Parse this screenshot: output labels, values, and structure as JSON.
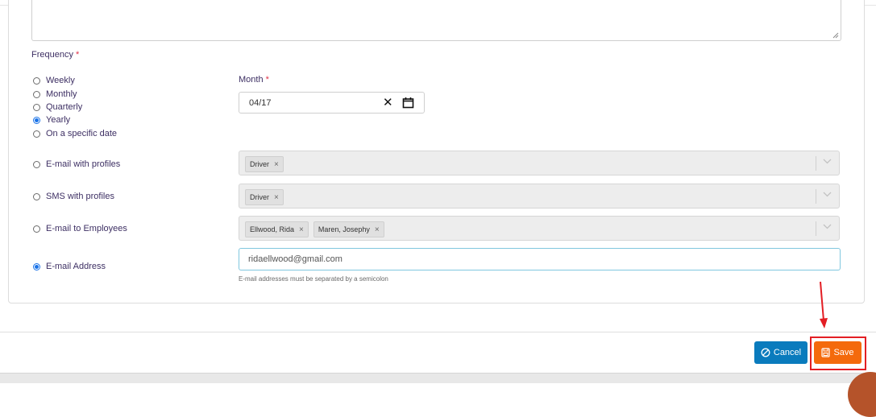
{
  "frequency": {
    "label": "Frequency",
    "required_mark": "*",
    "options": [
      "Weekly",
      "Monthly",
      "Quarterly",
      "Yearly",
      "On a specific date"
    ],
    "selected": "Yearly"
  },
  "month": {
    "label": "Month",
    "required_mark": "*",
    "value": "04/17"
  },
  "recipients": {
    "email_profiles": {
      "label": "E-mail with profiles",
      "tags": [
        "Driver"
      ]
    },
    "sms_profiles": {
      "label": "SMS with profiles",
      "tags": [
        "Driver"
      ]
    },
    "email_employees": {
      "label": "E-mail to Employees",
      "tags": [
        "Ellwood, Rida",
        "Maren, Josephy"
      ]
    },
    "email_address": {
      "label": "E-mail Address",
      "value": "ridaellwood@gmail.com",
      "hint": "E-mail addresses must be separated by a semicolon"
    },
    "selected": "E-mail Address"
  },
  "actions": {
    "cancel_label": "Cancel",
    "save_label": "Save"
  },
  "tag_remove_glyph": "×",
  "colors": {
    "cancel": "#0a7bbd",
    "save": "#f46a0c",
    "radio_checked": "#1a73e8",
    "annotation": "#e31e24"
  }
}
